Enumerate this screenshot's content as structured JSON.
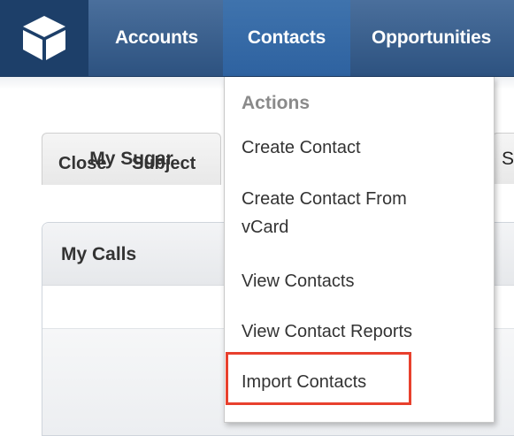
{
  "nav": {
    "logo_icon": "cube-icon",
    "items": [
      {
        "label": "Accounts"
      },
      {
        "label": "Contacts",
        "active": true
      },
      {
        "label": "Opportunities"
      }
    ]
  },
  "tabs": [
    {
      "label": "My Sugar"
    },
    {
      "label": "S"
    }
  ],
  "dashlet": {
    "title": "My Calls",
    "columns": [
      "Close",
      "Subject"
    ]
  },
  "menu": {
    "header": "Actions",
    "items": [
      {
        "label": "Create Contact"
      },
      {
        "label_line1": "Create Contact From",
        "label_line2": "vCard"
      },
      {
        "label": "View Contacts"
      },
      {
        "label": "View Contact Reports"
      },
      {
        "label": "Import Contacts",
        "highlighted": true
      }
    ],
    "highlight_color": "#e8402d"
  },
  "colors": {
    "nav_bg": "#2d5280",
    "nav_active": "#2e62a0",
    "logo_bg": "#1d3f69"
  }
}
